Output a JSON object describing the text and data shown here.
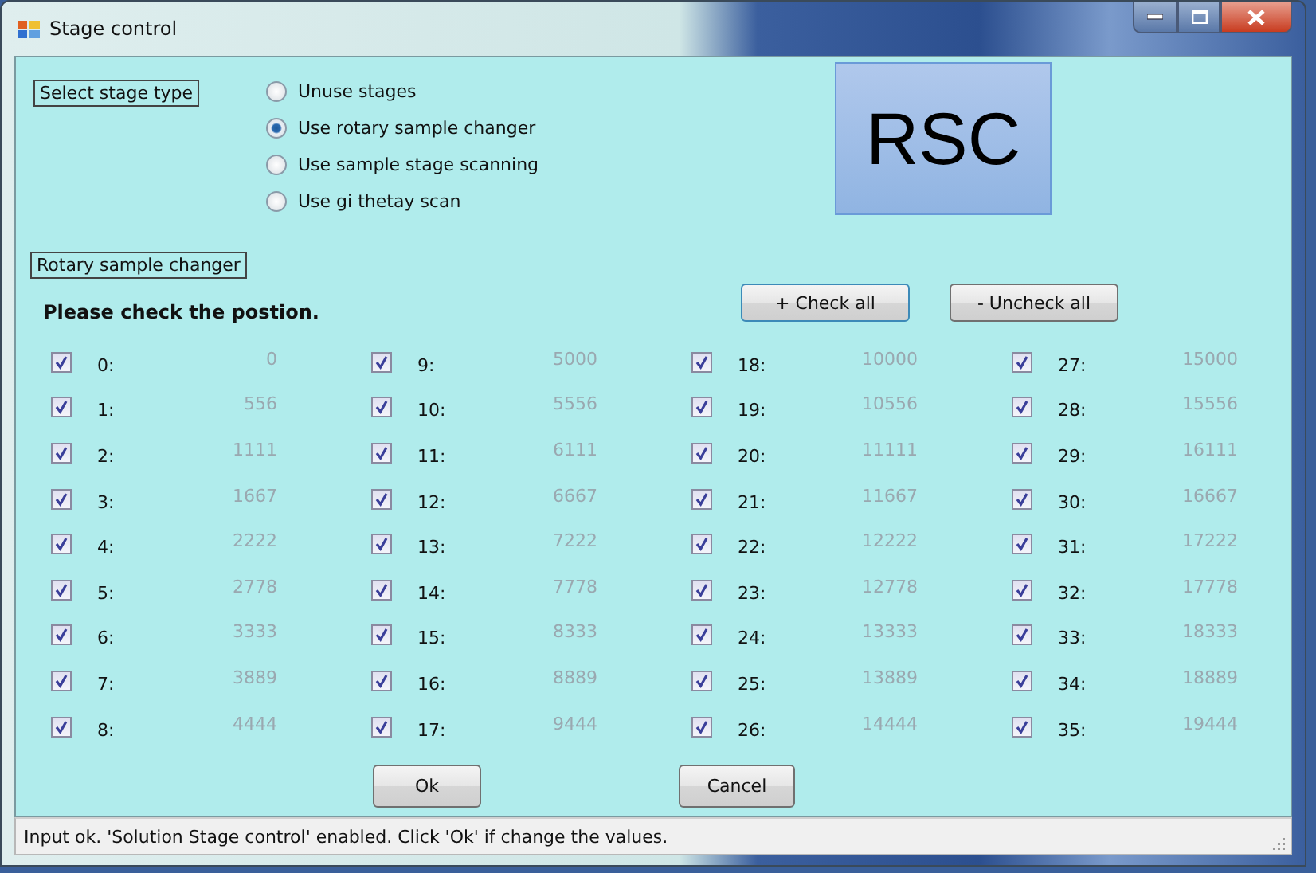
{
  "window": {
    "title": "Stage control"
  },
  "stage_type": {
    "label": "Select stage type",
    "options": [
      {
        "label": "Unuse stages",
        "selected": false
      },
      {
        "label": "Use rotary sample changer",
        "selected": true
      },
      {
        "label": "Use sample stage scanning",
        "selected": false
      },
      {
        "label": "Use gi thetay scan",
        "selected": false
      }
    ]
  },
  "mode_badge": "RSC",
  "rotary": {
    "label": "Rotary sample changer",
    "instruction": "Please check the postion.",
    "check_all": "+ Check all",
    "uncheck_all": "- Uncheck all",
    "positions": [
      {
        "label": "0:",
        "value": "0",
        "checked": true
      },
      {
        "label": "1:",
        "value": "556",
        "checked": true
      },
      {
        "label": "2:",
        "value": "1111",
        "checked": true
      },
      {
        "label": "3:",
        "value": "1667",
        "checked": true
      },
      {
        "label": "4:",
        "value": "2222",
        "checked": true
      },
      {
        "label": "5:",
        "value": "2778",
        "checked": true
      },
      {
        "label": "6:",
        "value": "3333",
        "checked": true
      },
      {
        "label": "7:",
        "value": "3889",
        "checked": true
      },
      {
        "label": "8:",
        "value": "4444",
        "checked": true
      },
      {
        "label": "9:",
        "value": "5000",
        "checked": true
      },
      {
        "label": "10:",
        "value": "5556",
        "checked": true
      },
      {
        "label": "11:",
        "value": "6111",
        "checked": true
      },
      {
        "label": "12:",
        "value": "6667",
        "checked": true
      },
      {
        "label": "13:",
        "value": "7222",
        "checked": true
      },
      {
        "label": "14:",
        "value": "7778",
        "checked": true
      },
      {
        "label": "15:",
        "value": "8333",
        "checked": true
      },
      {
        "label": "16:",
        "value": "8889",
        "checked": true
      },
      {
        "label": "17:",
        "value": "9444",
        "checked": true
      },
      {
        "label": "18:",
        "value": "10000",
        "checked": true
      },
      {
        "label": "19:",
        "value": "10556",
        "checked": true
      },
      {
        "label": "20:",
        "value": "11111",
        "checked": true
      },
      {
        "label": "21:",
        "value": "11667",
        "checked": true
      },
      {
        "label": "22:",
        "value": "12222",
        "checked": true
      },
      {
        "label": "23:",
        "value": "12778",
        "checked": true
      },
      {
        "label": "24:",
        "value": "13333",
        "checked": true
      },
      {
        "label": "25:",
        "value": "13889",
        "checked": true
      },
      {
        "label": "26:",
        "value": "14444",
        "checked": true
      },
      {
        "label": "27:",
        "value": "15000",
        "checked": true
      },
      {
        "label": "28:",
        "value": "15556",
        "checked": true
      },
      {
        "label": "29:",
        "value": "16111",
        "checked": true
      },
      {
        "label": "30:",
        "value": "16667",
        "checked": true
      },
      {
        "label": "31:",
        "value": "17222",
        "checked": true
      },
      {
        "label": "32:",
        "value": "17778",
        "checked": true
      },
      {
        "label": "33:",
        "value": "18333",
        "checked": true
      },
      {
        "label": "34:",
        "value": "18889",
        "checked": true
      },
      {
        "label": "35:",
        "value": "19444",
        "checked": true
      }
    ]
  },
  "buttons": [
    "Ok",
    "Cancel"
  ],
  "status_bar": "Input ok. 'Solution Stage control' enabled. Click 'Ok' if change the values."
}
